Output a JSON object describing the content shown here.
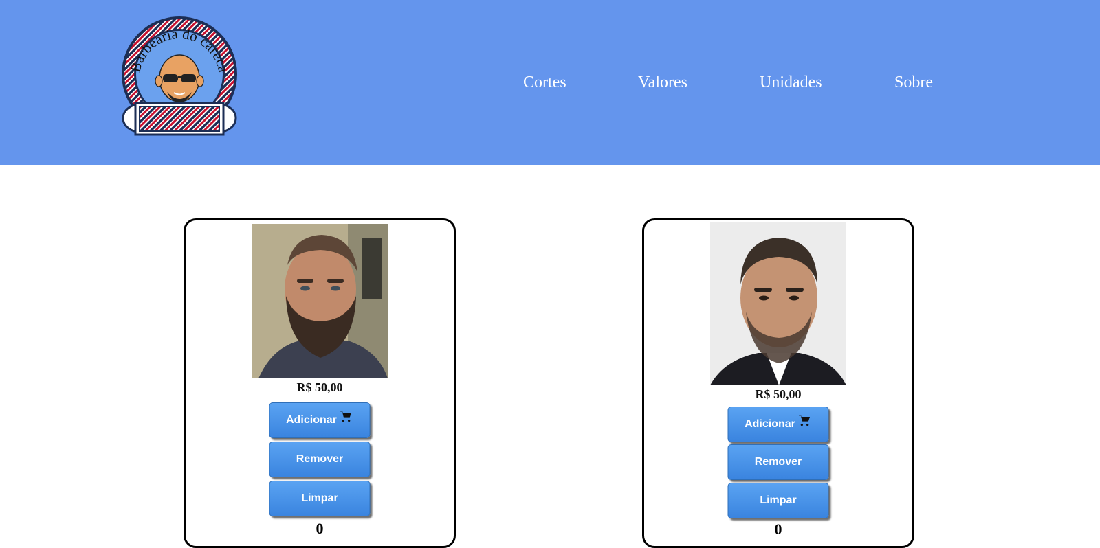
{
  "header": {
    "logo": {
      "text": "Barbearia do careca",
      "colors": {
        "navy": "#1c2e55",
        "red": "#c8102e",
        "face": "#e8a263"
      }
    },
    "nav": [
      {
        "label": "Cortes"
      },
      {
        "label": "Valores"
      },
      {
        "label": "Unidades"
      },
      {
        "label": "Sobre"
      }
    ],
    "background": "#6495ed"
  },
  "products": [
    {
      "photo_alt": "man-with-beard-photo",
      "price": "R$ 50,00",
      "add_label": "Adicionar",
      "remove_label": "Remover",
      "clear_label": "Limpar",
      "quantity": "0"
    },
    {
      "photo_alt": "man-buzz-cut-photo",
      "price": "R$ 50,00",
      "add_label": "Adicionar",
      "remove_label": "Remover",
      "clear_label": "Limpar",
      "quantity": "0"
    }
  ],
  "icons": {
    "cart": "cart-icon"
  }
}
